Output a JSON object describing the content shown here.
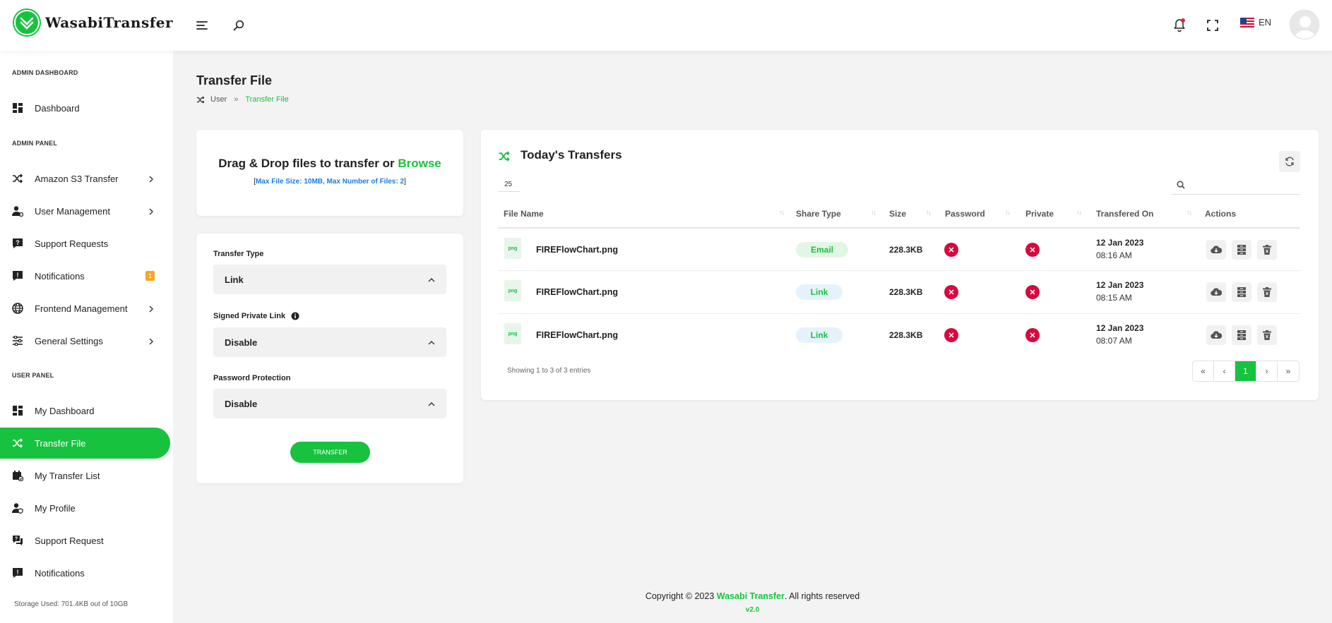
{
  "app": {
    "name": "WasabiTransfer"
  },
  "header": {
    "language": "EN"
  },
  "sidebar": {
    "sections": [
      {
        "title": "ADMIN DASHBOARD"
      },
      {
        "title": "ADMIN PANEL"
      },
      {
        "title": "USER PANEL"
      }
    ],
    "items": [
      {
        "label": "Dashboard"
      },
      {
        "label": "Amazon S3 Transfer"
      },
      {
        "label": "User Management"
      },
      {
        "label": "Support Requests"
      },
      {
        "label": "Notifications",
        "badge": "1"
      },
      {
        "label": "Frontend Management"
      },
      {
        "label": "General Settings"
      },
      {
        "label": "My Dashboard"
      },
      {
        "label": "Transfer File"
      },
      {
        "label": "My Transfer List"
      },
      {
        "label": "My Profile"
      },
      {
        "label": "Support Request"
      },
      {
        "label": "Notifications"
      }
    ],
    "storage": "Storage Used: 701.4KB out of 10GB"
  },
  "page": {
    "title": "Transfer File",
    "breadcrumb": {
      "parent": "User",
      "separator": "»",
      "current": "Transfer File"
    }
  },
  "upload": {
    "title": "Drag & Drop files to transfer or ",
    "browse": "Browse",
    "bracket_open": "[",
    "info": "Max File Size: 10MB, Max Number of Files: 2",
    "bracket_close": "]"
  },
  "form": {
    "transfer_type_label": "Transfer Type",
    "transfer_type_value": "Link",
    "signed_link_label": "Signed Private Link",
    "signed_link_value": "Disable",
    "password_label": "Password Protection",
    "password_value": "Disable",
    "submit_label": "TRANSFER"
  },
  "transfers": {
    "title": "Today's Transfers",
    "page_length": "25",
    "columns": [
      "File Name",
      "Share Type",
      "Size",
      "Password",
      "Private",
      "Transfered On",
      "Actions"
    ],
    "rows": [
      {
        "icon_text": "png",
        "name": "FIREFlowChart.png",
        "share": "Email",
        "size": "228.3KB",
        "date": "12 Jan 2023",
        "time": "08:16 AM"
      },
      {
        "icon_text": "png",
        "name": "FIREFlowChart.png",
        "share": "Link",
        "size": "228.3KB",
        "date": "12 Jan 2023",
        "time": "08:15 AM"
      },
      {
        "icon_text": "png",
        "name": "FIREFlowChart.png",
        "share": "Link",
        "size": "228.3KB",
        "date": "12 Jan 2023",
        "time": "08:07 AM"
      }
    ],
    "info": "Showing 1 to 3 of 3 entries",
    "pagination": {
      "first": "«",
      "prev": "‹",
      "current": "1",
      "next": "›",
      "last": "»"
    }
  },
  "footer": {
    "prefix": "Copyright © 2023 ",
    "brand": "Wasabi Transfer",
    "suffix": ". All rights reserved",
    "version": "v2.0"
  },
  "colors": {
    "accent": "#17c23e",
    "danger": "#d7093f",
    "badge": "#f5a623",
    "info_blue": "#1e7be0"
  }
}
